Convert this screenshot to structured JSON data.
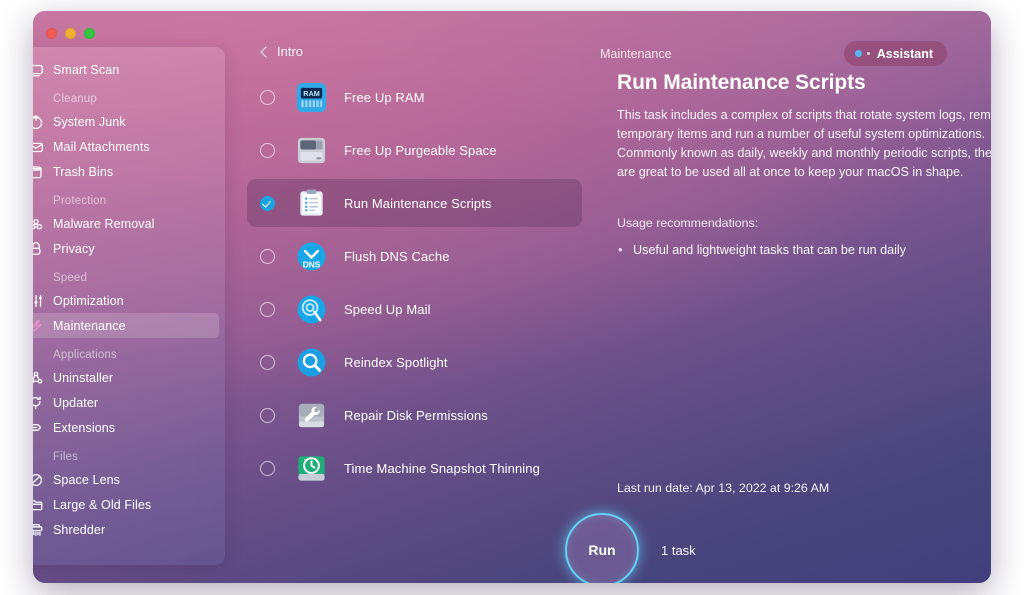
{
  "window": {
    "traffic_lights": [
      {
        "name": "close",
        "color": "#f25c54"
      },
      {
        "name": "minimize",
        "color": "#f0b22e"
      },
      {
        "name": "maximize",
        "color": "#34c642"
      }
    ]
  },
  "topbar": {
    "back_label": "Intro",
    "title": "Maintenance",
    "assistant_label": "Assistant",
    "assistant_dot_color": "#56b7f0"
  },
  "sidebar": {
    "items": [
      {
        "type": "item",
        "label": "Smart Scan",
        "icon": "smart-scan-icon",
        "selected": false
      },
      {
        "type": "group",
        "label": "Cleanup"
      },
      {
        "type": "item",
        "label": "System Junk",
        "icon": "system-junk-icon",
        "selected": false
      },
      {
        "type": "item",
        "label": "Mail Attachments",
        "icon": "mail-attachments-icon",
        "selected": false
      },
      {
        "type": "item",
        "label": "Trash Bins",
        "icon": "trash-bins-icon",
        "selected": false
      },
      {
        "type": "group",
        "label": "Protection"
      },
      {
        "type": "item",
        "label": "Malware Removal",
        "icon": "malware-removal-icon",
        "selected": false
      },
      {
        "type": "item",
        "label": "Privacy",
        "icon": "privacy-icon",
        "selected": false
      },
      {
        "type": "group",
        "label": "Speed"
      },
      {
        "type": "item",
        "label": "Optimization",
        "icon": "optimization-icon",
        "selected": false
      },
      {
        "type": "item",
        "label": "Maintenance",
        "icon": "maintenance-icon",
        "selected": true
      },
      {
        "type": "group",
        "label": "Applications"
      },
      {
        "type": "item",
        "label": "Uninstaller",
        "icon": "uninstaller-icon",
        "selected": false
      },
      {
        "type": "item",
        "label": "Updater",
        "icon": "updater-icon",
        "selected": false
      },
      {
        "type": "item",
        "label": "Extensions",
        "icon": "extensions-icon",
        "selected": false
      },
      {
        "type": "group",
        "label": "Files"
      },
      {
        "type": "item",
        "label": "Space Lens",
        "icon": "space-lens-icon",
        "selected": false
      },
      {
        "type": "item",
        "label": "Large & Old Files",
        "icon": "large-old-files-icon",
        "selected": false
      },
      {
        "type": "item",
        "label": "Shredder",
        "icon": "shredder-icon",
        "selected": false
      }
    ]
  },
  "tasks": [
    {
      "label": "Free Up RAM",
      "icon": "ram-chip-icon",
      "checked": false,
      "selected": false
    },
    {
      "label": "Free Up Purgeable Space",
      "icon": "hard-drive-icon",
      "checked": false,
      "selected": false
    },
    {
      "label": "Run Maintenance Scripts",
      "icon": "clipboard-list-icon",
      "checked": true,
      "selected": true
    },
    {
      "label": "Flush DNS Cache",
      "icon": "dns-icon",
      "checked": false,
      "selected": false
    },
    {
      "label": "Speed Up Mail",
      "icon": "speed-up-mail-icon",
      "checked": false,
      "selected": false
    },
    {
      "label": "Reindex Spotlight",
      "icon": "spotlight-icon",
      "checked": false,
      "selected": false
    },
    {
      "label": "Repair Disk Permissions",
      "icon": "wrench-disk-icon",
      "checked": false,
      "selected": false
    },
    {
      "label": "Time Machine Snapshot Thinning",
      "icon": "time-machine-icon",
      "checked": false,
      "selected": false
    }
  ],
  "detail": {
    "title": "Run Maintenance Scripts",
    "description": "This task includes a complex of scripts that rotate system logs, remove temporary items and run a number of useful system optimizations. Commonly known as daily, weekly and monthly periodic scripts, they are great to be used all at once to keep your macOS in shape.",
    "usage_heading": "Usage recommendations:",
    "usage_items": [
      "Useful and lightweight tasks that can be run daily"
    ],
    "last_run": "Last run date:  Apr 13, 2022 at 9:26 AM"
  },
  "footer": {
    "run_label": "Run",
    "task_count": "1 task",
    "run_ring_color": "#63d2f5"
  }
}
